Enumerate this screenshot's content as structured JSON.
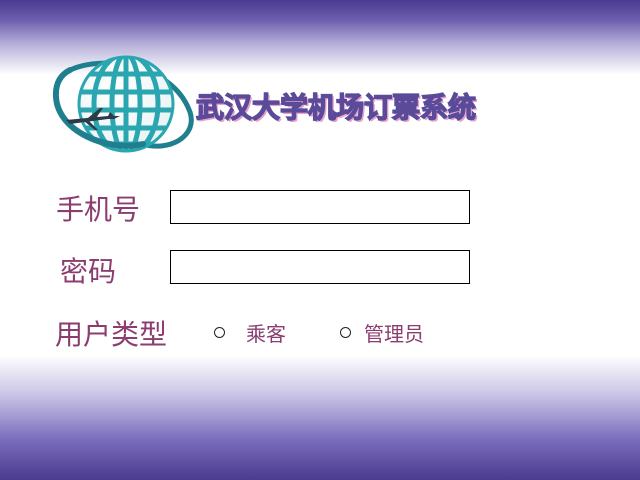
{
  "app": {
    "title": "武汉大学机场订票系统"
  },
  "form": {
    "phone_label": "手机号",
    "phone_value": "",
    "password_label": "密码",
    "password_value": "",
    "user_type_label": "用户类型",
    "user_type_options": [
      "乘客",
      "管理员"
    ],
    "user_type_selected": ""
  },
  "icons": {
    "logo": "globe-with-airplane-icon",
    "radio": "radio-icon"
  },
  "colors": {
    "label": "#8a3d6e",
    "band": "#4b3a8f",
    "globe": "#2aa6b0"
  }
}
